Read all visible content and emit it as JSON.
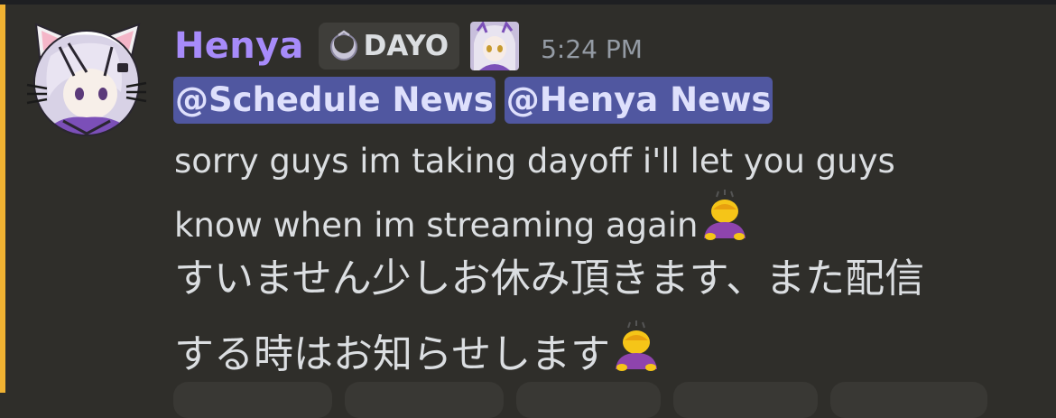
{
  "message": {
    "username": "Henya",
    "server_tag": "DAYO",
    "timestamp": "5:24 PM",
    "mentions": [
      "@Schedule News",
      "@Henya News"
    ],
    "lines_en": [
      "sorry guys im taking dayoff i'll let you guys",
      "know when im streaming again"
    ],
    "lines_jp": [
      "すいません少しお休み頂きます、また配信",
      "する時はお知らせします"
    ]
  },
  "colors": {
    "username": "#a78bfa",
    "mention_bg": "#5057a0",
    "highlight_bar": "#f0b232",
    "background": "#2f2e2a"
  },
  "icons": [
    "avatar-image",
    "moon-tag-icon",
    "role-icon",
    "person-bowing-emoji"
  ]
}
